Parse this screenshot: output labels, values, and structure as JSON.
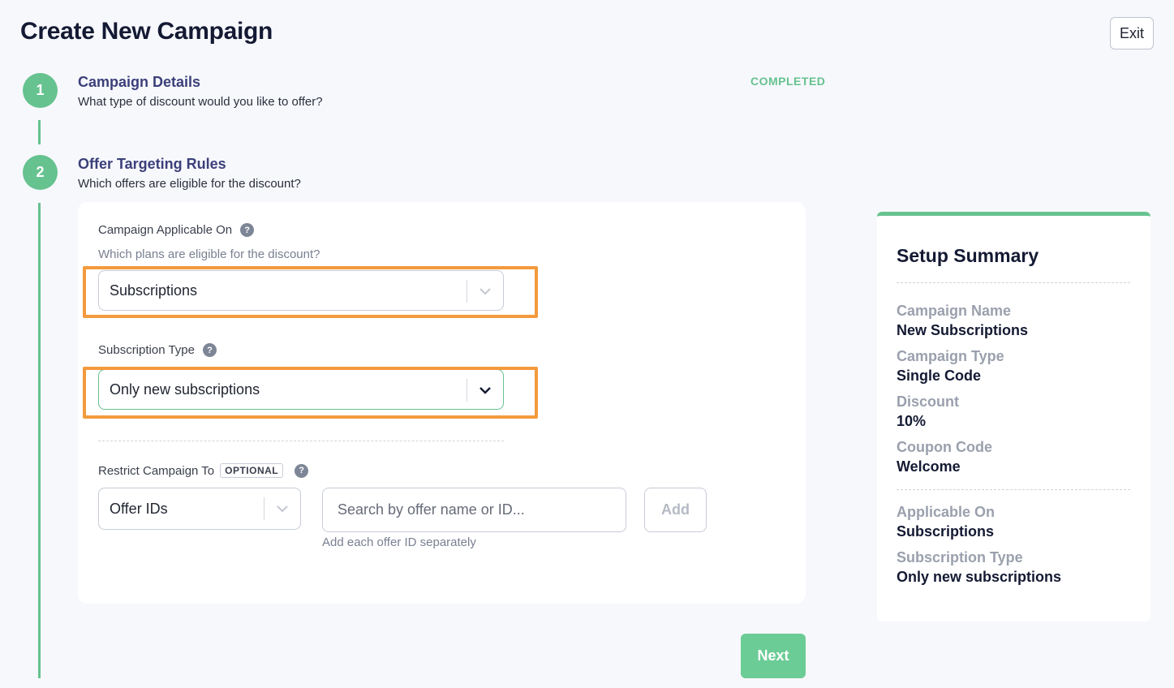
{
  "header": {
    "title": "Create New Campaign",
    "exit_label": "Exit"
  },
  "steps": [
    {
      "number": "1",
      "title": "Campaign Details",
      "subtitle": "What type of discount would you like to offer?",
      "status": "COMPLETED"
    },
    {
      "number": "2",
      "title": "Offer Targeting Rules",
      "subtitle": "Which offers are eligible for the discount?"
    }
  ],
  "form": {
    "applicable_on": {
      "label": "Campaign Applicable On",
      "hint": "Which plans are eligible for the discount?",
      "value": "Subscriptions"
    },
    "subscription_type": {
      "label": "Subscription Type",
      "value": "Only new subscriptions"
    },
    "restrict": {
      "label": "Restrict Campaign To",
      "badge": "OPTIONAL",
      "type_value": "Offer IDs",
      "search_placeholder": "Search by offer name or ID...",
      "add_label": "Add",
      "hint": "Add each offer ID separately"
    },
    "next_label": "Next"
  },
  "summary": {
    "title": "Setup Summary",
    "items": [
      {
        "label": "Campaign Name",
        "value": "New Subscriptions"
      },
      {
        "label": "Campaign Type",
        "value": "Single Code"
      },
      {
        "label": "Discount",
        "value": "10%"
      },
      {
        "label": "Coupon Code",
        "value": "Welcome"
      },
      {
        "label": "Applicable On",
        "value": "Subscriptions"
      },
      {
        "label": "Subscription Type",
        "value": "Only new subscriptions"
      }
    ]
  },
  "colors": {
    "accent": "#66c28f",
    "highlight": "#f39a3d",
    "heading": "#3b3f7a"
  },
  "icons": {
    "help": "help-circle-icon",
    "dropdown": "chevron-down-icon"
  }
}
